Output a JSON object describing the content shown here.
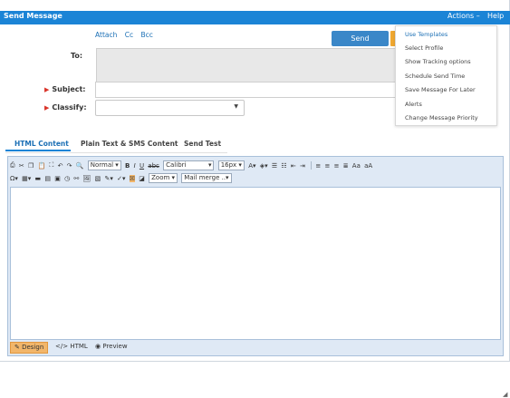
{
  "titlebar": {
    "title": "Send Message",
    "actions": "Actions",
    "actions_caret": "–",
    "help": "Help"
  },
  "links": {
    "attach": "Attach",
    "cc": "Cc",
    "bcc": "Bcc"
  },
  "send_button": "Send",
  "fields": {
    "to_label": "To:",
    "subject_label": "Subject:",
    "classify_label": "Classify:",
    "required_marker": "▶"
  },
  "menu": {
    "items": [
      "Use Templates",
      "Select Profile",
      "Show Tracking options",
      "Schedule Send Time",
      "Save Message For Later",
      "Alerts",
      "Change Message Priority"
    ]
  },
  "tabs": [
    "HTML Content",
    "Plain Text & SMS Content",
    "Send Test"
  ],
  "editor": {
    "style_select": "Normal",
    "font_select": "Calibri",
    "size_select": "16px",
    "zoom_select": "Zoom",
    "mailmerge_select": "Mail merge ..",
    "modes": {
      "design": "Design",
      "html": "HTML",
      "preview": "Preview"
    }
  },
  "colors": {
    "titlebar": "#1b84d6",
    "send": "#3a87c8",
    "accent": "#f0a830",
    "link": "#1b6fb5"
  }
}
